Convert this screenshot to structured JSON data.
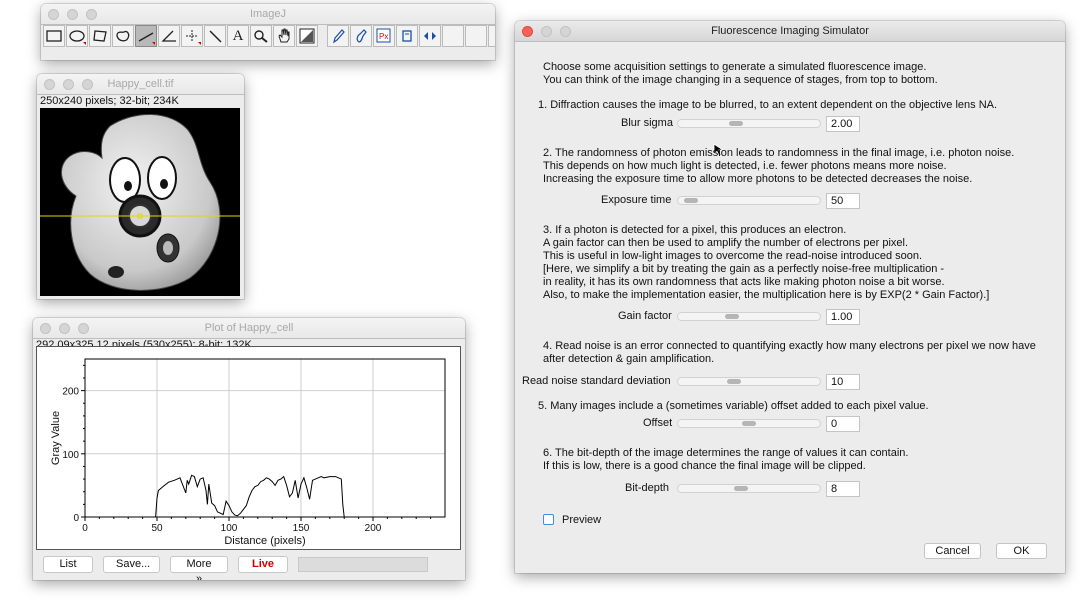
{
  "imagej": {
    "title": "ImageJ",
    "tools": [
      "rectangle-tool",
      "oval-tool",
      "polygon-tool",
      "freehand-tool",
      "line-tool",
      "angle-tool",
      "point-tool",
      "wand-tool",
      "text-tool",
      "magnifier-tool",
      "hand-tool",
      "color-picker-tool",
      "pencil-tool",
      "brush-tool",
      "pixel-inspector-tool",
      "tool-10",
      "tool-11",
      "empty-slot",
      "empty-slot",
      "empty-slot",
      "more-tools"
    ],
    "more_glyph": "≫",
    "text_glyph": "A"
  },
  "image_window": {
    "title": "Happy_cell.tif",
    "info": "250x240 pixels; 32-bit; 234K"
  },
  "plot_window": {
    "title": "Plot of Happy_cell",
    "info": "292.09x325.12 pixels (530x255); 8-bit; 132K",
    "buttons": {
      "list": "List",
      "save": "Save...",
      "more": "More »",
      "live": "Live"
    }
  },
  "chart_data": {
    "type": "line",
    "xlabel": "Distance (pixels)",
    "ylabel": "Gray Value",
    "xlim": [
      0,
      250
    ],
    "ylim": [
      0,
      250
    ],
    "x_ticks": [
      0,
      50,
      100,
      150,
      200
    ],
    "y_ticks": [
      0,
      100,
      200
    ],
    "grid": true,
    "series": [
      {
        "x": [
          0,
          49,
          50,
          51,
          54,
          58,
          62,
          64,
          66,
          68,
          70,
          71,
          72,
          74,
          76,
          78,
          80,
          82,
          84,
          85,
          86,
          88,
          90,
          92,
          94,
          96,
          98,
          100,
          102,
          104,
          106,
          108,
          110,
          112,
          114,
          116,
          118,
          120,
          122,
          124,
          126,
          128,
          130,
          132,
          134,
          136,
          138,
          140,
          142,
          144,
          146,
          148,
          150,
          152,
          154,
          156,
          158,
          160,
          162,
          164,
          166,
          170,
          174,
          178,
          179,
          180,
          181,
          250
        ],
        "y": [
          0,
          0,
          30,
          42,
          48,
          55,
          58,
          60,
          62,
          50,
          38,
          58,
          52,
          66,
          64,
          48,
          60,
          62,
          42,
          20,
          52,
          22,
          18,
          8,
          6,
          4,
          25,
          18,
          8,
          3,
          2,
          6,
          12,
          18,
          32,
          42,
          48,
          50,
          56,
          58,
          62,
          60,
          56,
          50,
          58,
          60,
          64,
          50,
          32,
          38,
          58,
          30,
          52,
          62,
          46,
          28,
          58,
          60,
          62,
          64,
          62,
          64,
          64,
          60,
          20,
          0,
          0,
          0
        ]
      }
    ]
  },
  "dialog": {
    "title": "Fluorescence Imaging Simulator",
    "intro": [
      "Choose some acquisition settings to generate a simulated fluorescence image.",
      "You can think of the image changing in a sequence of stages, from top to bottom."
    ],
    "sec1": "1. Diffraction causes the image to be blurred, to an extent dependent on the objective lens NA.",
    "blur": {
      "label": "Blur sigma",
      "value": "2.00",
      "level": 0.4
    },
    "sec2": [
      "2. The randomness of photon emission leads to randomness in the final image, i.e. photon noise.",
      "This depends on how much light is detected, i.e. fewer photons means more noise.",
      "Increasing the exposure time to allow more photons to be detected decreases the noise."
    ],
    "exposure": {
      "label": "Exposure time",
      "value": "50",
      "level": 0.05
    },
    "sec3": [
      "3. If a photon is detected for a pixel, this produces an electron.",
      "A gain factor can then be used to amplify the number of electrons per pixel.",
      "This is useful in low-light images to overcome the read-noise introduced soon.",
      "[Here, we simplify a bit by treating the gain as a perfectly noise-free multiplication -",
      "in reality, it has its own randomness that acts like making photon noise a bit worse.",
      "Also, to make the implementation easier, the multiplication here is by EXP(2 * Gain Factor).]"
    ],
    "gain": {
      "label": "Gain factor",
      "value": "1.00",
      "level": 0.37
    },
    "sec4": [
      "4. Read noise is an error connected to quantifying exactly how many electrons per pixel we now have",
      "after detection & gain amplification."
    ],
    "readnoise": {
      "label": "Read noise standard deviation",
      "value": "10",
      "level": 0.38
    },
    "sec5": "5. Many images include a (sometimes variable) offset added to each pixel value.",
    "offset": {
      "label": "Offset",
      "value": "0",
      "level": 0.5
    },
    "sec6": [
      "6. The bit-depth of the image determines the range of values it can contain.",
      "If this is low, there is a good chance the final image will be clipped."
    ],
    "bitdepth": {
      "label": "Bit-depth",
      "value": "8",
      "level": 0.44
    },
    "preview": "Preview",
    "cancel": "Cancel",
    "ok": "OK"
  }
}
